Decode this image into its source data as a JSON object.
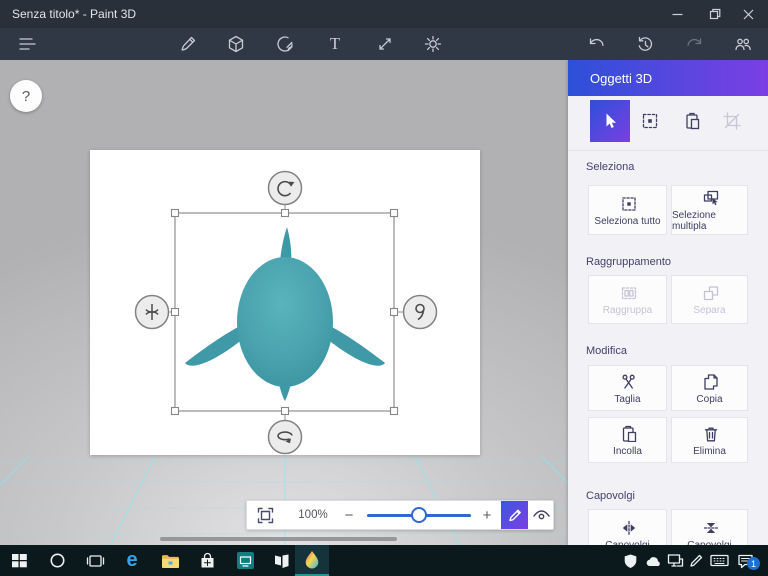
{
  "window": {
    "title": "Senza titolo* - Paint 3D"
  },
  "toolbar": {
    "text_tool_glyph": "T"
  },
  "workspace": {
    "help_label": "?",
    "object": "3d-shark-teal",
    "object_selected": true
  },
  "zoombar": {
    "zoom_level": "100%",
    "zoom_out": "−",
    "zoom_in": "+"
  },
  "panel": {
    "title": "Oggetti 3D",
    "sections": {
      "seleziona": {
        "label": "Seleziona",
        "buttons": {
          "select_all": "Seleziona tutto",
          "multi_select": "Selezione multipla"
        }
      },
      "raggruppamento": {
        "label": "Raggruppamento",
        "buttons": {
          "group": "Raggruppa",
          "ungroup": "Separa"
        }
      },
      "modifica": {
        "label": "Modifica",
        "buttons": {
          "cut": "Taglia",
          "copy": "Copia",
          "paste": "Incolla",
          "delete": "Elimina"
        }
      },
      "capovolgi": {
        "label": "Capovolgi",
        "buttons": {
          "flip_h": "Capovolgi",
          "flip_v": "Capovolgi"
        }
      }
    }
  },
  "taskbar": {
    "edge_glyph": "e",
    "notification_count": "1"
  },
  "icons": {
    "titlebar": [
      "minimize-icon",
      "restore-icon",
      "close-icon"
    ],
    "toolbar": [
      "menu-icon",
      "brush-icon",
      "3d-shapes-icon",
      "stickers-icon",
      "text-icon",
      "canvas-icon",
      "effects-icon",
      "undo-icon",
      "history-icon",
      "redo-icon",
      "remix-3d-icon"
    ],
    "panel_tools": [
      "select-icon",
      "select-all-icon",
      "paste-icon",
      "crop-icon"
    ],
    "zoombar": [
      "fit-to-view-icon",
      "pencil-icon",
      "eye-icon"
    ],
    "canvas_handles": [
      "rotate-z-icon",
      "rotate-tilt-icon",
      "rotate-y-icon",
      "rotate-depth-icon"
    ],
    "taskbar": [
      "start-icon",
      "cortana-icon",
      "task-view-icon",
      "edge-icon",
      "file-explorer-icon",
      "store-icon",
      "film-tv-icon",
      "photos-icon",
      "paint3d-icon",
      "defender-icon",
      "onedrive-icon",
      "network-icon",
      "pen-icon",
      "keyboard-icon",
      "action-center-icon"
    ]
  },
  "colors": {
    "header_gradient_start": "#2d50d8",
    "header_gradient_end": "#7b3fe4",
    "object_teal": "#4aa3ae",
    "slider_blue": "#2e68d0",
    "titlebar_bg": "#293039",
    "taskbar_bg": "#0c191c"
  }
}
